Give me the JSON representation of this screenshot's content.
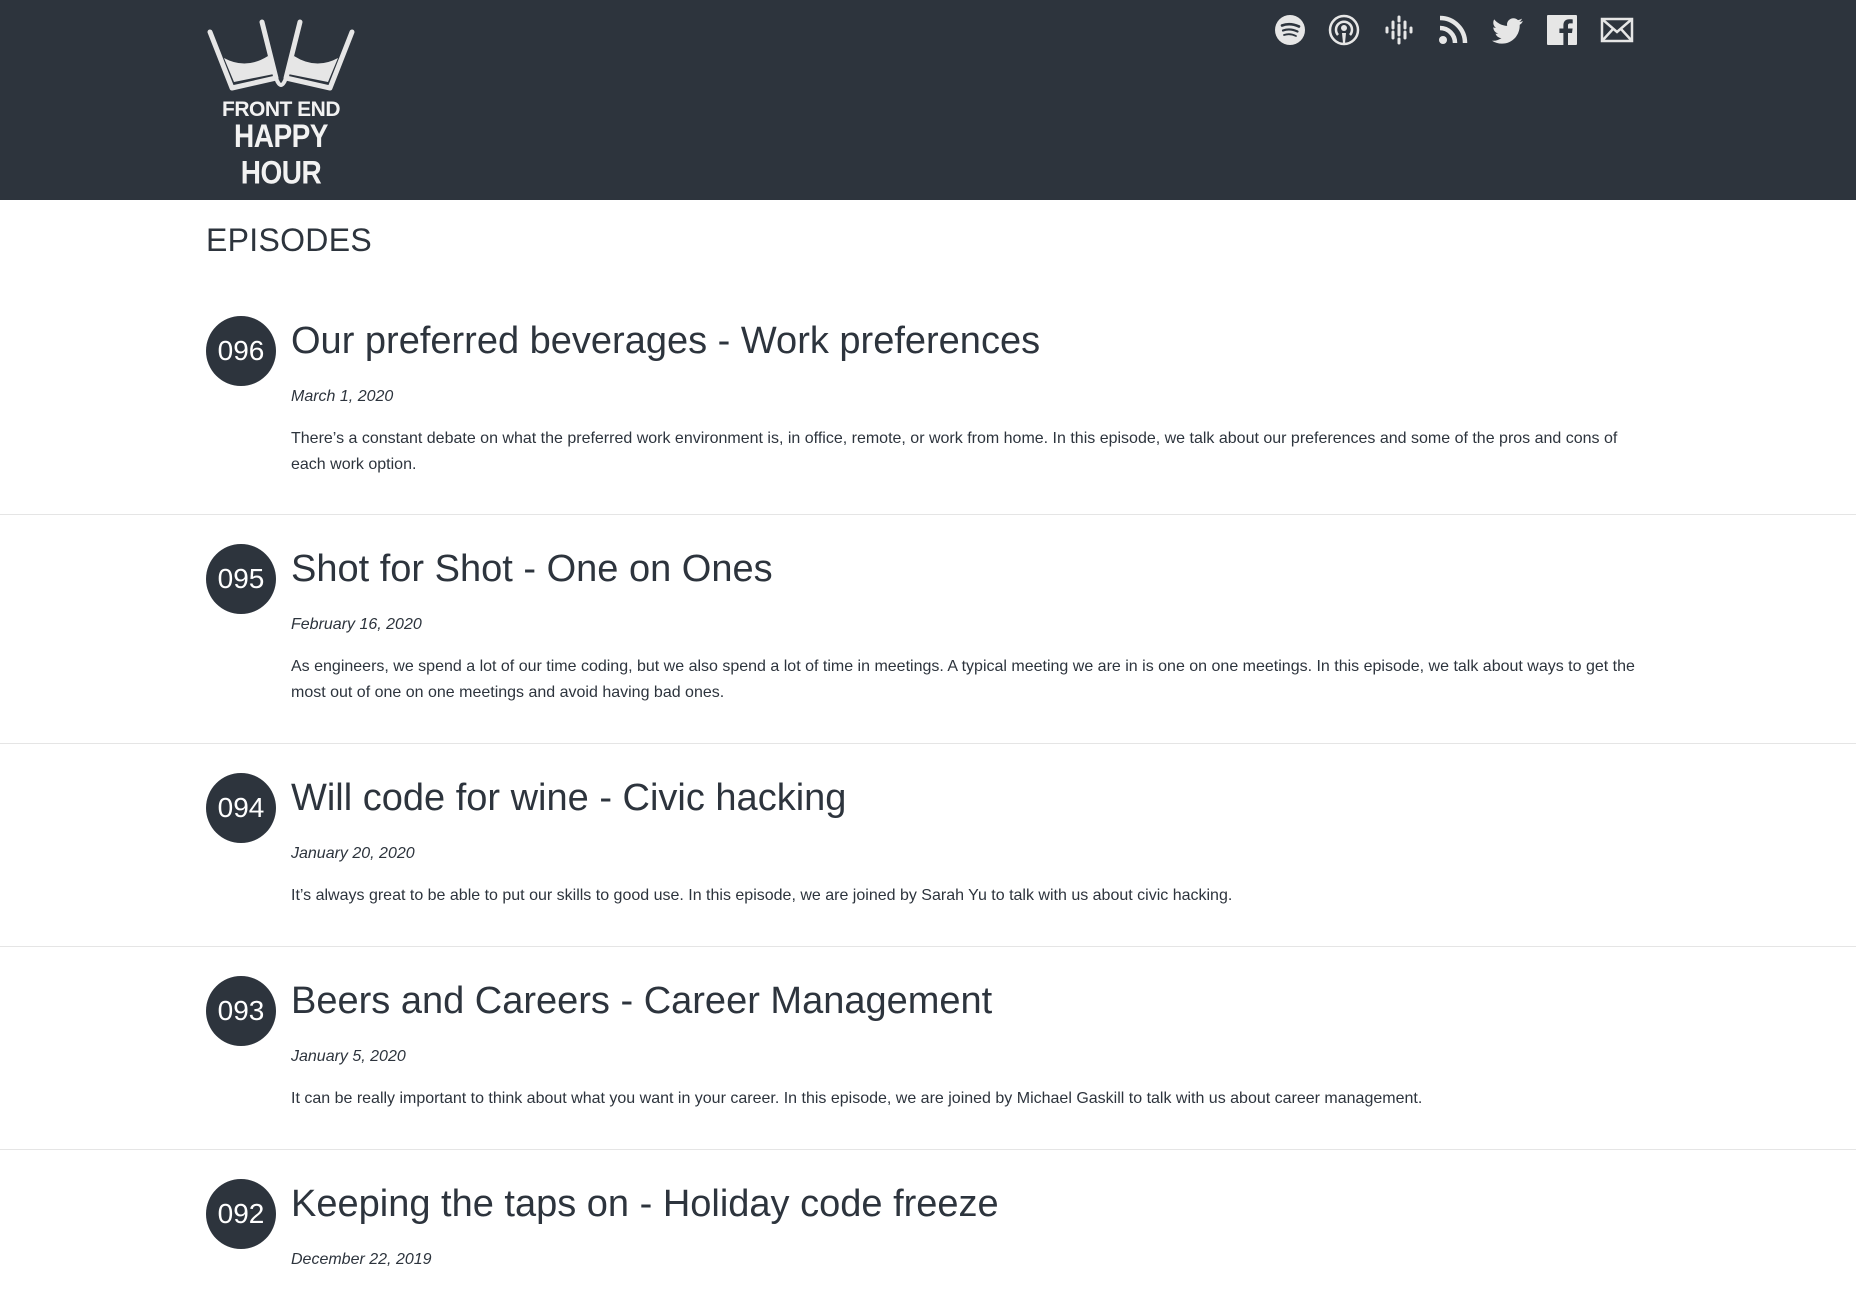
{
  "site": {
    "logo_line1": "FRONT END",
    "logo_line2": "HAPPY HOUR"
  },
  "social_icons": [
    "spotify-icon",
    "apple-podcasts-icon",
    "google-podcasts-icon",
    "rss-icon",
    "twitter-icon",
    "facebook-icon",
    "email-icon"
  ],
  "page": {
    "heading": "EPISODES"
  },
  "episodes": [
    {
      "number": "096",
      "title": "Our preferred beverages - Work preferences",
      "date": "March 1, 2020",
      "description": "There’s a constant debate on what the preferred work environment is, in office, remote, or work from home. In this episode, we talk about our preferences and some of the pros and cons of each work option."
    },
    {
      "number": "095",
      "title": "Shot for Shot - One on Ones",
      "date": "February 16, 2020",
      "description": "As engineers, we spend a lot of our time coding, but we also spend a lot of time in meetings. A typical meeting we are in is one on one meetings. In this episode, we talk about ways to get the most out of one on one meetings and avoid having bad ones."
    },
    {
      "number": "094",
      "title": "Will code for wine - Civic hacking",
      "date": "January 20, 2020",
      "description": "It’s always great to be able to put our skills to good use. In this episode, we are joined by Sarah Yu to talk with us about civic hacking."
    },
    {
      "number": "093",
      "title": "Beers and Careers - Career Management",
      "date": "January 5, 2020",
      "description": "It can be really important to think about what you want in your career. In this episode, we are joined by Michael Gaskill to talk with us about career management."
    },
    {
      "number": "092",
      "title": "Keeping the taps on - Holiday code freeze",
      "date": "December 22, 2019",
      "description": ""
    }
  ],
  "colors": {
    "header_bg": "#2d343d",
    "text": "#2d343d",
    "icon": "#e6e6e6",
    "divider": "#e5e5e5"
  }
}
